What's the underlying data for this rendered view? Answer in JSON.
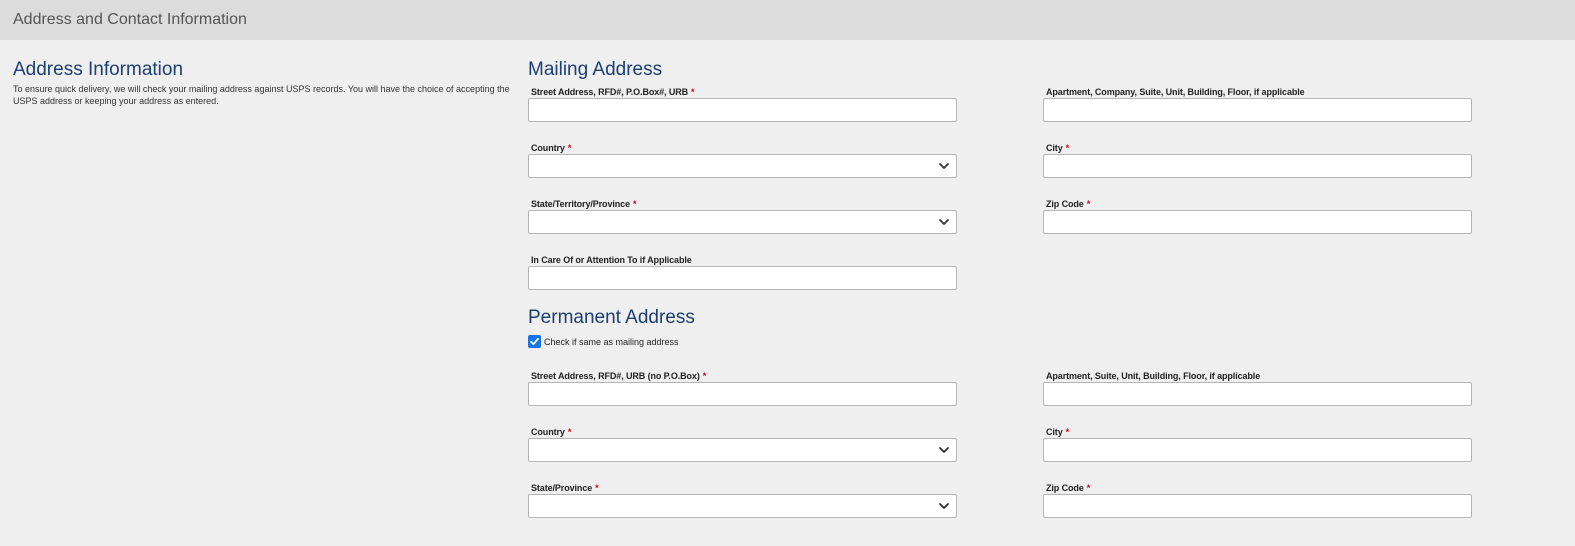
{
  "header": {
    "title": "Address and Contact Information"
  },
  "address_info": {
    "heading": "Address Information",
    "description": "To ensure quick delivery, we will check your mailing address against USPS records. You will have the choice of accepting the USPS address or keeping your address as entered."
  },
  "required_marker": "*",
  "mailing": {
    "heading": "Mailing Address",
    "street_label": "Street Address, RFD#, P.O.Box#, URB",
    "street_value": "",
    "apartment_label": "Apartment, Company, Suite, Unit, Building, Floor, if applicable",
    "apartment_value": "",
    "country_label": "Country",
    "country_value": "",
    "city_label": "City",
    "city_value": "",
    "state_label": "State/Territory/Province",
    "state_value": "",
    "zip_label": "Zip Code",
    "zip_value": "",
    "care_of_label": "In Care Of or Attention To if Applicable",
    "care_of_value": ""
  },
  "permanent": {
    "heading": "Permanent Address",
    "same_as_mailing_label": "Check if same as mailing address",
    "same_as_mailing_checked": true,
    "street_label": "Street Address, RFD#, URB (no P.O.Box)",
    "street_value": "",
    "apartment_label": "Apartment, Suite, Unit, Building, Floor, if applicable",
    "apartment_value": "",
    "country_label": "Country",
    "country_value": "",
    "city_label": "City",
    "city_value": "",
    "state_label": "State/Province",
    "state_value": "",
    "zip_label": "Zip Code",
    "zip_value": ""
  },
  "icons": {
    "select_arrow": "chevron-down-icon",
    "checkbox_mark": "checkmark-icon"
  },
  "colors": {
    "heading": "#1b3f73",
    "required": "#d0021b",
    "checkbox": "#1a73e8",
    "header_bar": "#dcdcdc",
    "page_background": "#efefef"
  }
}
